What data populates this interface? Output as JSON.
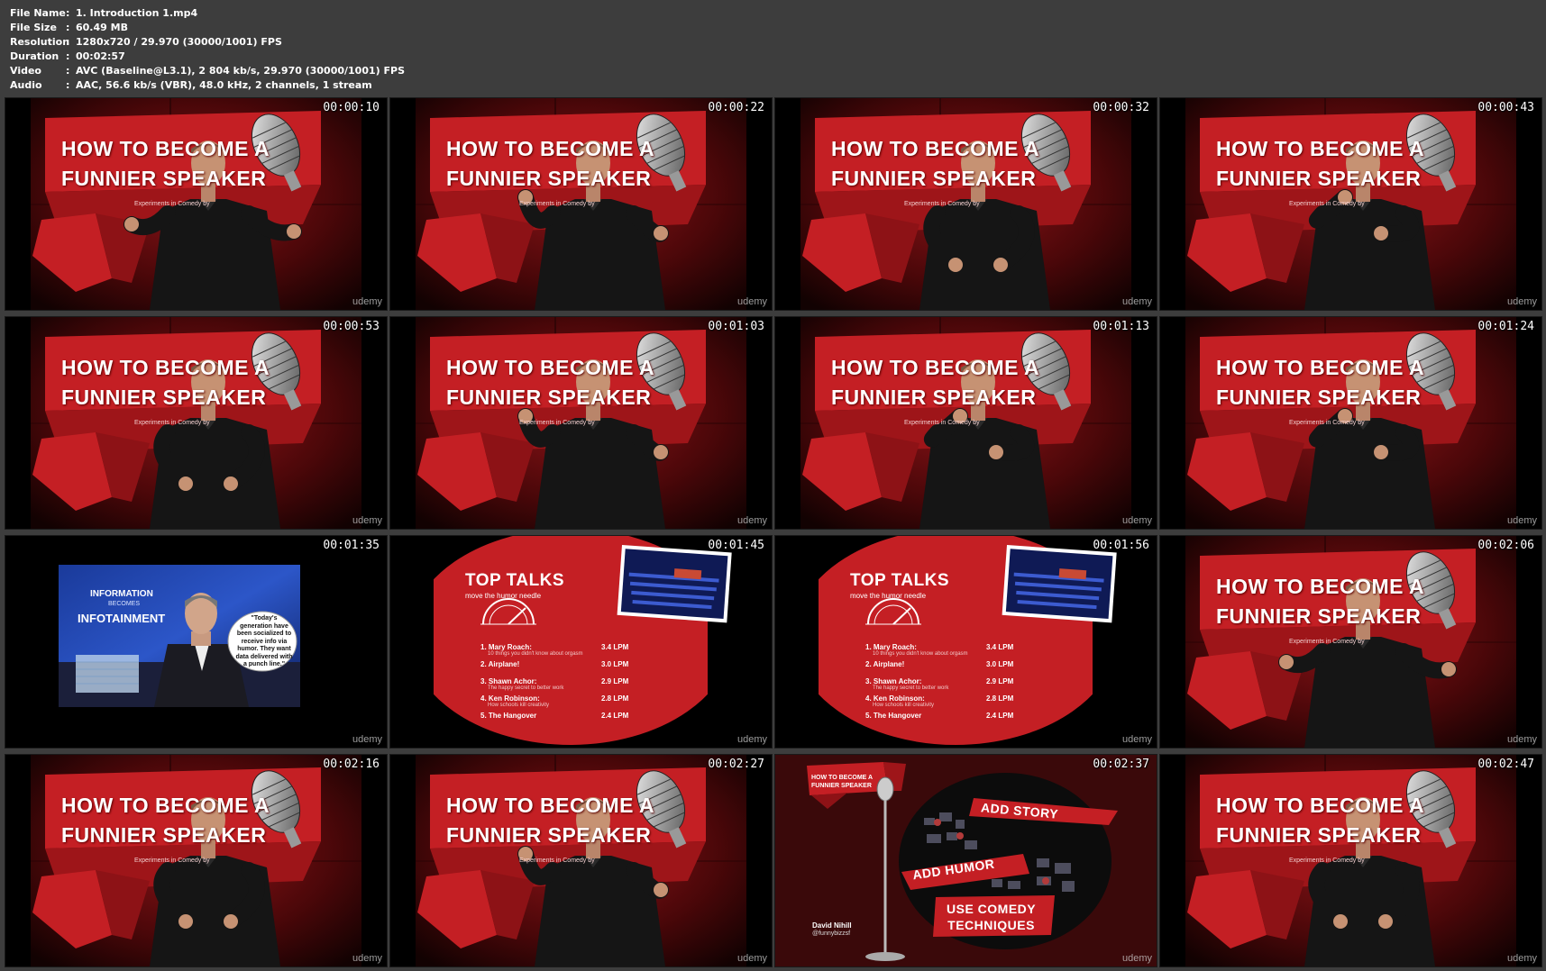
{
  "info": [
    {
      "key": "File Name",
      "value": "1. Introduction 1.mp4"
    },
    {
      "key": "File Size",
      "value": "60.49 MB"
    },
    {
      "key": "Resolution",
      "value": "1280x720 / 29.970 (30000/1001) FPS"
    },
    {
      "key": "Duration",
      "value": "00:02:57"
    },
    {
      "key": "Video",
      "value": "AVC (Baseline@L3.1), 2 804 kb/s, 29.970 (30000/1001) FPS"
    },
    {
      "key": "Audio",
      "value": "AAC, 56.6 kb/s (VBR), 48.0 kHz, 2 channels, 1 stream"
    }
  ],
  "separator": ":",
  "watermark": "udemy",
  "speaker_slide": {
    "title_line1": "HOW TO BECOME A",
    "title_line2": "FUNNIER SPEAKER",
    "subtitle": "Experiments in Comedy by"
  },
  "info_slide": {
    "line1": "INFORMATION",
    "line2": "BECOMES",
    "line3": "INFOTAINMENT",
    "quote": "\"Today's generation have been socialized to receive info via humor. They want data delivered with a punch line.\""
  },
  "top_talks_slide": {
    "title": "TOP TALKS",
    "subtitle": "move the humor needle",
    "items": [
      {
        "name": "1. Mary Roach:",
        "desc": "10 things you didn't know about orgasm",
        "score": "3.4  LPM"
      },
      {
        "name": "2. Airplane!",
        "desc": "",
        "score": "3.0  LPM"
      },
      {
        "name": "3. Shawn Achor:",
        "desc": "The happy secret to better work",
        "score": "2.9  LPM"
      },
      {
        "name": "4. Ken Robinson:",
        "desc": "How schools kill creativity",
        "score": "2.8  LPM"
      },
      {
        "name": "5. The Hangover",
        "desc": "",
        "score": "2.4  LPM"
      }
    ]
  },
  "story_slide": {
    "title_line1": "HOW TO BECOME A",
    "title_line2": "FUNNIER SPEAKER",
    "banner1": "ADD STORY",
    "banner2": "ADD HUMOR",
    "banner3_line1": "USE COMEDY",
    "banner3_line2": "TECHNIQUES",
    "author": "David Nihill",
    "handle": "@funnybizzsf"
  },
  "thumbnails": [
    {
      "time": "00:00:10",
      "scene": "speaker",
      "pose": 0
    },
    {
      "time": "00:00:22",
      "scene": "speaker",
      "pose": 1
    },
    {
      "time": "00:00:32",
      "scene": "speaker",
      "pose": 2
    },
    {
      "time": "00:00:43",
      "scene": "speaker",
      "pose": 3
    },
    {
      "time": "00:00:53",
      "scene": "speaker",
      "pose": 2
    },
    {
      "time": "00:01:03",
      "scene": "speaker",
      "pose": 1
    },
    {
      "time": "00:01:13",
      "scene": "speaker",
      "pose": 3
    },
    {
      "time": "00:01:24",
      "scene": "speaker",
      "pose": 3
    },
    {
      "time": "00:01:35",
      "scene": "info",
      "pose": 0
    },
    {
      "time": "00:01:45",
      "scene": "toptalks",
      "pose": 0
    },
    {
      "time": "00:01:56",
      "scene": "toptalks",
      "pose": 0
    },
    {
      "time": "00:02:06",
      "scene": "speaker",
      "pose": 0
    },
    {
      "time": "00:02:16",
      "scene": "speaker",
      "pose": 2
    },
    {
      "time": "00:02:27",
      "scene": "speaker",
      "pose": 1
    },
    {
      "time": "00:02:37",
      "scene": "story",
      "pose": 0
    },
    {
      "time": "00:02:47",
      "scene": "speaker",
      "pose": 2
    }
  ],
  "colors": {
    "background": "#3d3d3d",
    "slide_red": "#c41f24",
    "dark_red": "#6d0c0e",
    "text": "#ffffff"
  }
}
